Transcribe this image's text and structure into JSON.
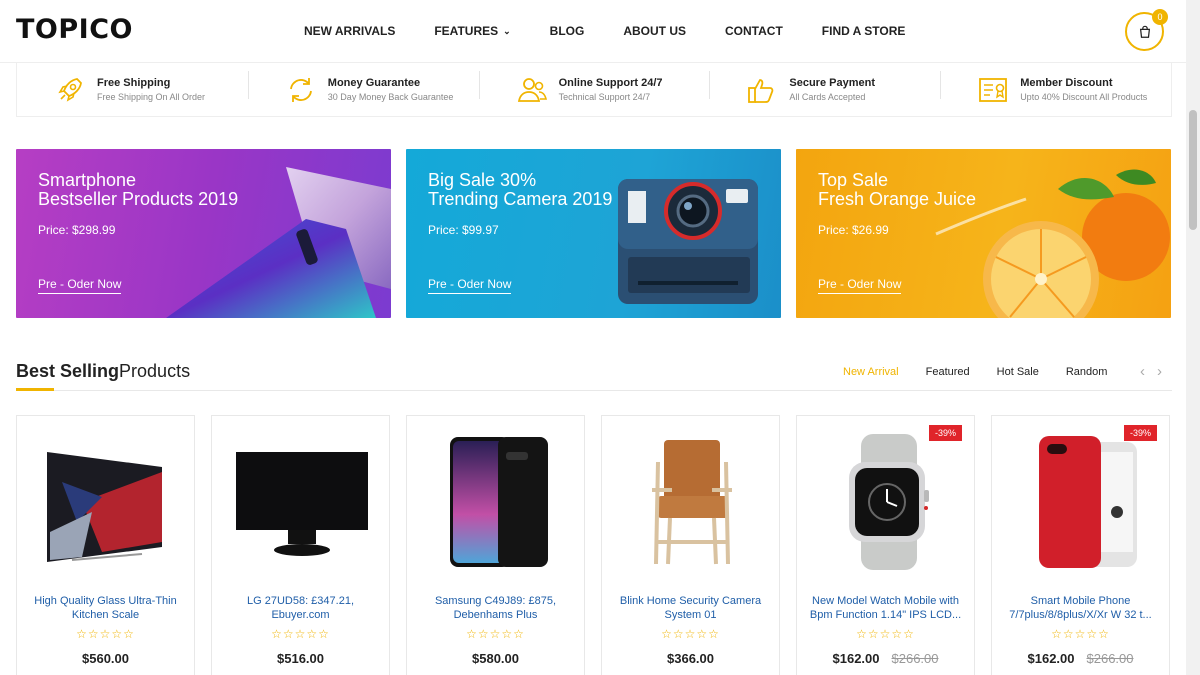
{
  "header": {
    "logo": "TOPICO",
    "nav": [
      "NEW ARRIVALS",
      "FEATURES",
      "BLOG",
      "ABOUT US",
      "CONTACT",
      "FIND A STORE"
    ],
    "cart_count": "0"
  },
  "features": [
    {
      "icon": "rocket-icon",
      "title": "Free Shipping",
      "subtitle": "Free Shipping On All Order"
    },
    {
      "icon": "refresh-icon",
      "title": "Money Guarantee",
      "subtitle": "30 Day Money Back Guarantee"
    },
    {
      "icon": "support-icon",
      "title": "Online Support 24/7",
      "subtitle": "Technical Support 24/7"
    },
    {
      "icon": "thumbs-up-icon",
      "title": "Secure Payment",
      "subtitle": "All Cards Accepted"
    },
    {
      "icon": "member-card-icon",
      "title": "Member Discount",
      "subtitle": "Upto 40% Discount All Products"
    }
  ],
  "banners": [
    {
      "title_line1": "Smartphone",
      "title_line2": "Bestseller Products 2019",
      "price": "Price: $298.99",
      "link": "Pre - Oder Now"
    },
    {
      "title_line1": "Big Sale 30%",
      "title_line2": "Trending Camera 2019",
      "price": "Price: $99.97",
      "link": "Pre - Oder Now"
    },
    {
      "title_line1": "Top Sale",
      "title_line2": "Fresh Orange Juice",
      "price": "Price: $26.99",
      "link": "Pre - Oder Now"
    }
  ],
  "section": {
    "title_bold": "Best Selling",
    "title_rest": "Products",
    "tabs": [
      "New Arrival",
      "Featured",
      "Hot Sale",
      "Random"
    ],
    "prev": "‹",
    "next": "›"
  },
  "products": [
    {
      "name": "High Quality Glass Ultra-Thin Kitchen Scale",
      "stars": "☆☆☆☆☆",
      "price": "$560.00",
      "old_price": "",
      "badge": ""
    },
    {
      "name": "LG 27UD58: £347.21, Ebuyer.com",
      "stars": "☆☆☆☆☆",
      "price": "$516.00",
      "old_price": "",
      "badge": ""
    },
    {
      "name": "Samsung C49J89: £875, Debenhams Plus",
      "stars": "☆☆☆☆☆",
      "price": "$580.00",
      "old_price": "",
      "badge": ""
    },
    {
      "name": "Blink Home Security Camera System 01",
      "stars": "☆☆☆☆☆",
      "price": "$366.00",
      "old_price": "",
      "badge": ""
    },
    {
      "name": "New Model Watch Mobile with Bpm Function 1.14\" IPS LCD...",
      "stars": "☆☆☆☆☆",
      "price": "$162.00",
      "old_price": "$266.00",
      "badge": "-39%"
    },
    {
      "name": "Smart Mobile Phone 7/7plus/8/8plus/X/Xr W 32 t...",
      "stars": "☆☆☆☆☆",
      "price": "$162.00",
      "old_price": "$266.00",
      "badge": "-39%"
    }
  ],
  "colors": {
    "accent": "#f0b400",
    "link": "#1f5ea8",
    "sale": "#e0242a"
  }
}
